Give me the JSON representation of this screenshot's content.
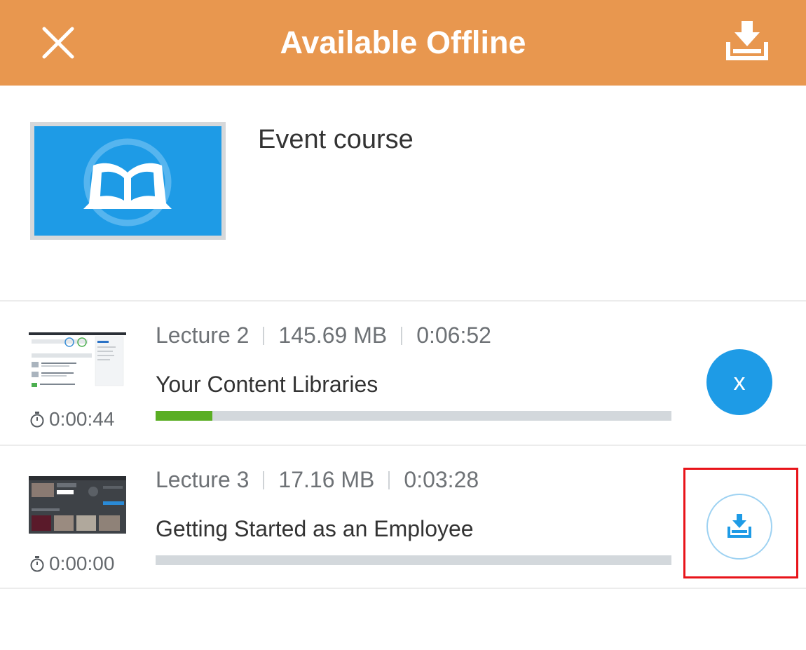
{
  "header": {
    "title": "Available Offline",
    "close_icon": "close-icon",
    "download_icon": "download-tray-icon",
    "background_color": "#E8974F"
  },
  "course": {
    "title": "Event course",
    "thumbnail_icon": "open-book-icon",
    "thumbnail_color": "#1E9BE6"
  },
  "lectures": [
    {
      "label": "Lecture 2",
      "size": "145.69 MB",
      "duration": "0:06:52",
      "title": "Your Content Libraries",
      "elapsed": "0:00:44",
      "progress_percent": 11,
      "progress_color": "#5AAE24",
      "action": "cancel",
      "action_label": "x"
    },
    {
      "label": "Lecture 3",
      "size": "17.16 MB",
      "duration": "0:03:28",
      "title": "Getting Started as an Employee",
      "elapsed": "0:00:00",
      "progress_percent": 0,
      "action": "download",
      "action_icon": "download-tray-icon"
    }
  ],
  "colors": {
    "accent_blue": "#1E9BE6",
    "highlight_red": "#E8141A"
  }
}
